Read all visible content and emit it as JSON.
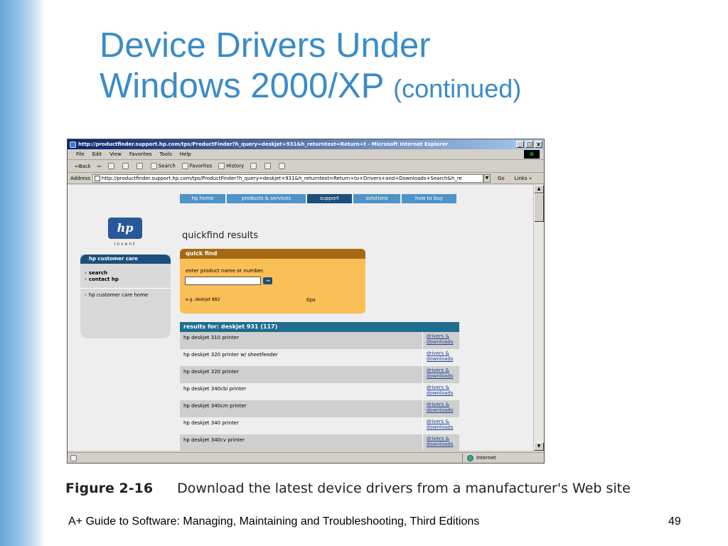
{
  "slide": {
    "title_line1": "Device Drivers Under",
    "title_line2": "Windows 2000/XP",
    "title_sub": "(continued)",
    "figure_label": "Figure 2-16",
    "figure_caption": "Download the latest device drivers from a manufacturer's Web site",
    "footer": "A+ Guide to Software: Managing, Maintaining and Troubleshooting, Third Editions",
    "page_number": "49"
  },
  "browser": {
    "title": "http://productfinder.support.hp.com/tps/ProductFinder?h_query=deskjet+931&h_returntext=Return+t - Microsoft Internet Explorer",
    "window_buttons": [
      "_",
      "□",
      "x"
    ],
    "menu": [
      "File",
      "Edit",
      "View",
      "Favorites",
      "Tools",
      "Help"
    ],
    "toolbar": {
      "back": "⇦Back",
      "forward": "⇨",
      "search": "Search",
      "favorites": "Favorites",
      "history": "History"
    },
    "address_label": "Address",
    "address_value": "http://productfinder.support.hp.com/tps/ProductFinder?h_query=deskjet+931&h_returntext=Return+to+Drivers+and+Downloads+Search&h_re",
    "go_label": "Go",
    "links_label": "Links »",
    "status_zone": "Internet"
  },
  "hp": {
    "nav": [
      "hp home",
      "products & services",
      "support",
      "solutions",
      "how to buy"
    ],
    "logo": "hp",
    "logo_tagline": "invent",
    "customer_care": {
      "header": "hp customer care",
      "links": [
        "search",
        "contact hp"
      ],
      "home_link": "hp customer care home"
    },
    "page_title": "quickfind results",
    "quickfind": {
      "header": "quick find",
      "label": "enter product name or number.",
      "go_button": "→",
      "example": "e.g. deskjet 882",
      "tips": "tips"
    },
    "results": {
      "header": "results for: deskjet 931 (117)",
      "download_line1": "drivers &",
      "download_line2": "downloads",
      "rows": [
        "hp deskjet 310 printer",
        "hp deskjet 320 printer w/ sheetfeeder",
        "hp deskjet 320 printer",
        "hp deskjet 340cbi printer",
        "hp deskjet 340cm printer",
        "hp deskjet 340 printer",
        "hp deskjet 340cv printer"
      ]
    }
  }
}
